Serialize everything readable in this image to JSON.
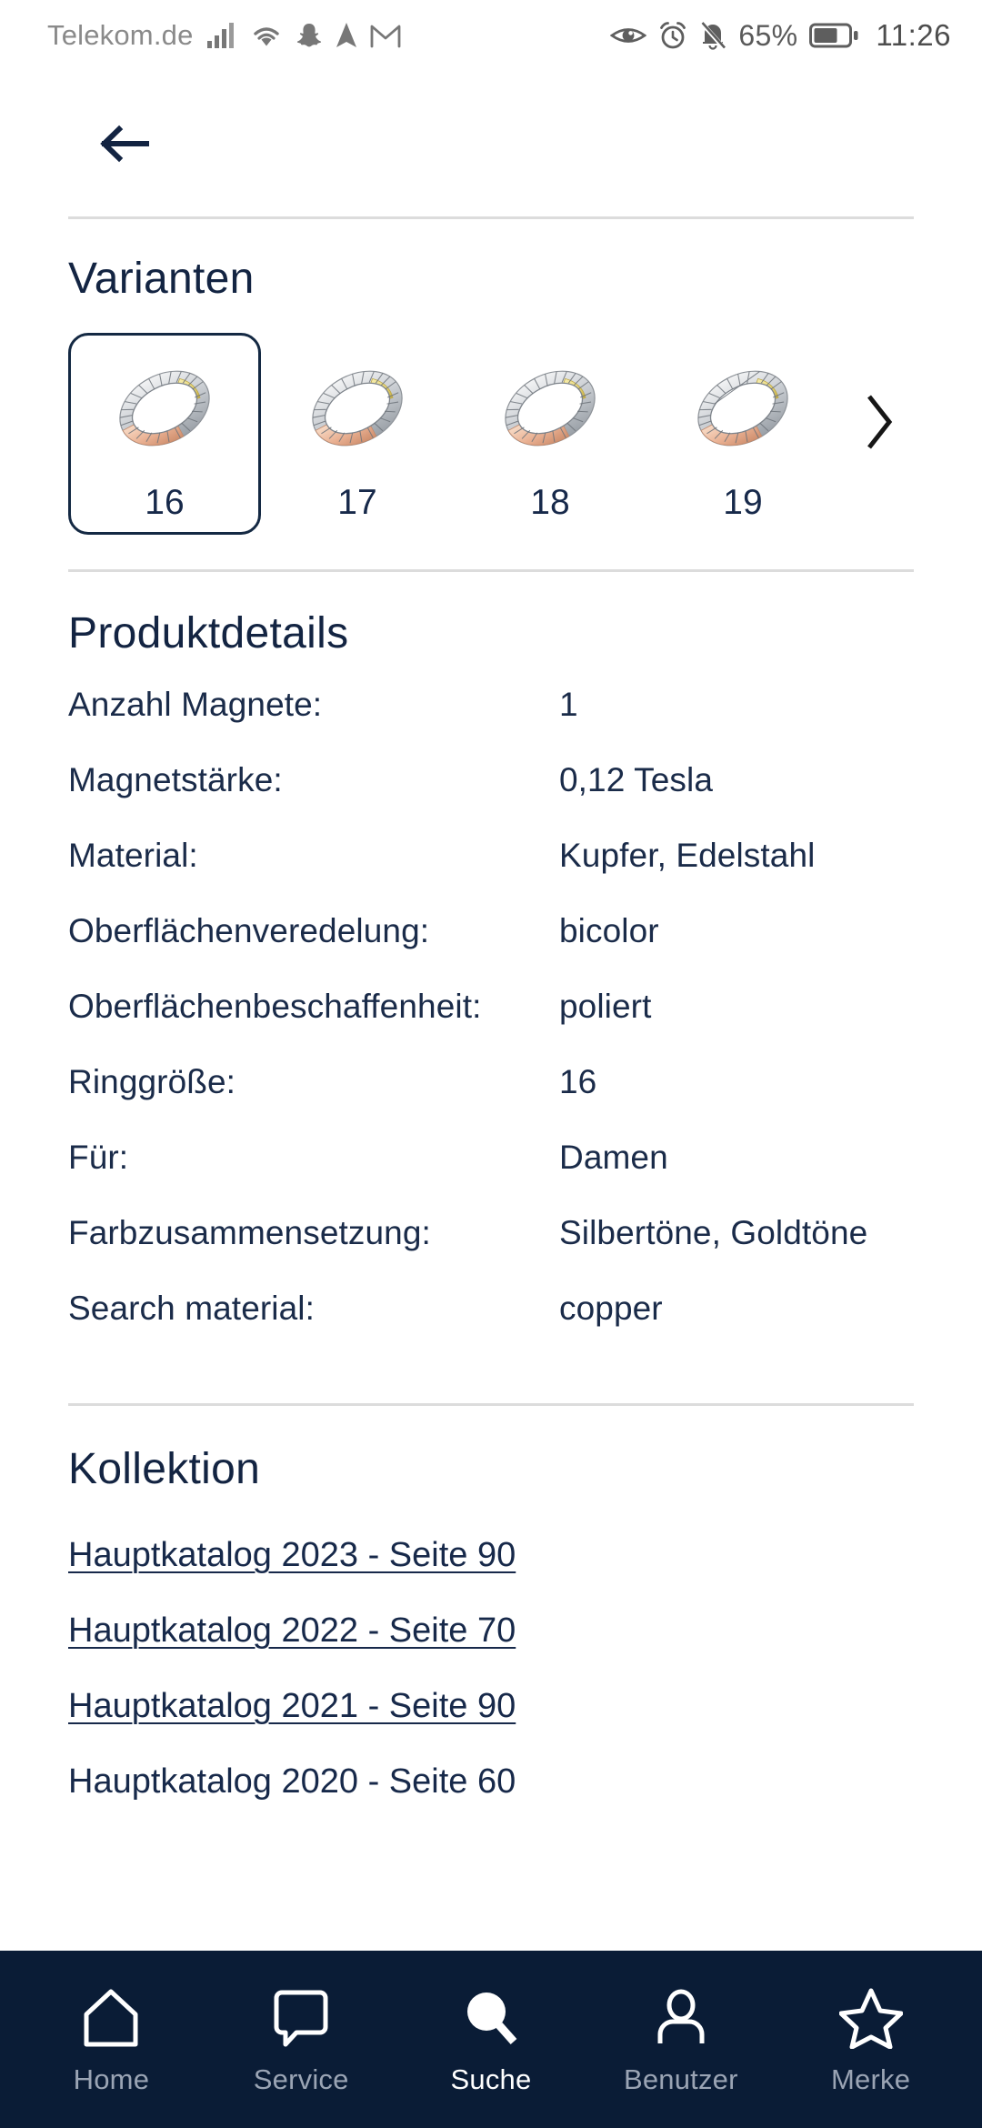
{
  "status_bar": {
    "carrier": "Telekom.de",
    "battery_percent": "65%",
    "clock": "11:26",
    "icons": [
      "signal-icon",
      "wifi-icon",
      "snapchat-icon",
      "navigation-icon",
      "gmail-icon",
      "eye-icon",
      "alarm-icon",
      "bell-muted-icon",
      "battery-icon"
    ]
  },
  "header": {
    "back_label": "back-arrow"
  },
  "varianten": {
    "title": "Varianten",
    "next_label": "›",
    "items": [
      {
        "label": "16",
        "selected": true
      },
      {
        "label": "17",
        "selected": false
      },
      {
        "label": "18",
        "selected": false
      },
      {
        "label": "19",
        "selected": false
      }
    ]
  },
  "produktdetails": {
    "title": "Produktdetails",
    "rows": [
      {
        "label": "Anzahl Magnete:",
        "value": "1"
      },
      {
        "label": "Magnetstärke:",
        "value": "0,12 Tesla"
      },
      {
        "label": "Material:",
        "value": "Kupfer, Edelstahl"
      },
      {
        "label": "Oberflächenveredelung:",
        "value": "bicolor"
      },
      {
        "label": "Oberflächenbeschaffenheit:",
        "value": "poliert"
      },
      {
        "label": "Ringgröße:",
        "value": "16"
      },
      {
        "label": "Für:",
        "value": "Damen"
      },
      {
        "label": "Farbzusammensetzung:",
        "value": "Silbertöne, Goldtöne"
      },
      {
        "label": "Search material:",
        "value": "copper"
      }
    ]
  },
  "kollektion": {
    "title": "Kollektion",
    "links": [
      {
        "label": "Hauptkatalog 2023 - Seite 90",
        "underlined": true
      },
      {
        "label": "Hauptkatalog 2022 - Seite 70",
        "underlined": true
      },
      {
        "label": "Hauptkatalog 2021 - Seite 90",
        "underlined": true
      },
      {
        "label": "Hauptkatalog 2020 - Seite 60",
        "underlined": false
      }
    ]
  },
  "bottom_nav": {
    "items": [
      {
        "label": "Home",
        "icon": "home-icon",
        "active": false
      },
      {
        "label": "Service",
        "icon": "chat-bubble-icon",
        "active": false
      },
      {
        "label": "Suche",
        "icon": "search-icon",
        "active": true
      },
      {
        "label": "Benutzer",
        "icon": "user-icon",
        "active": false
      },
      {
        "label": "Merke",
        "icon": "star-icon",
        "active": false
      }
    ]
  },
  "colors": {
    "brand_navy": "#0a1c36",
    "text_navy": "#17294a",
    "nav_inactive": "#9aa4b4",
    "divider": "#dcdcdc",
    "rose_gold": "#e8b595",
    "silver": "#c9ccd0",
    "gold": "#e8d77a"
  }
}
